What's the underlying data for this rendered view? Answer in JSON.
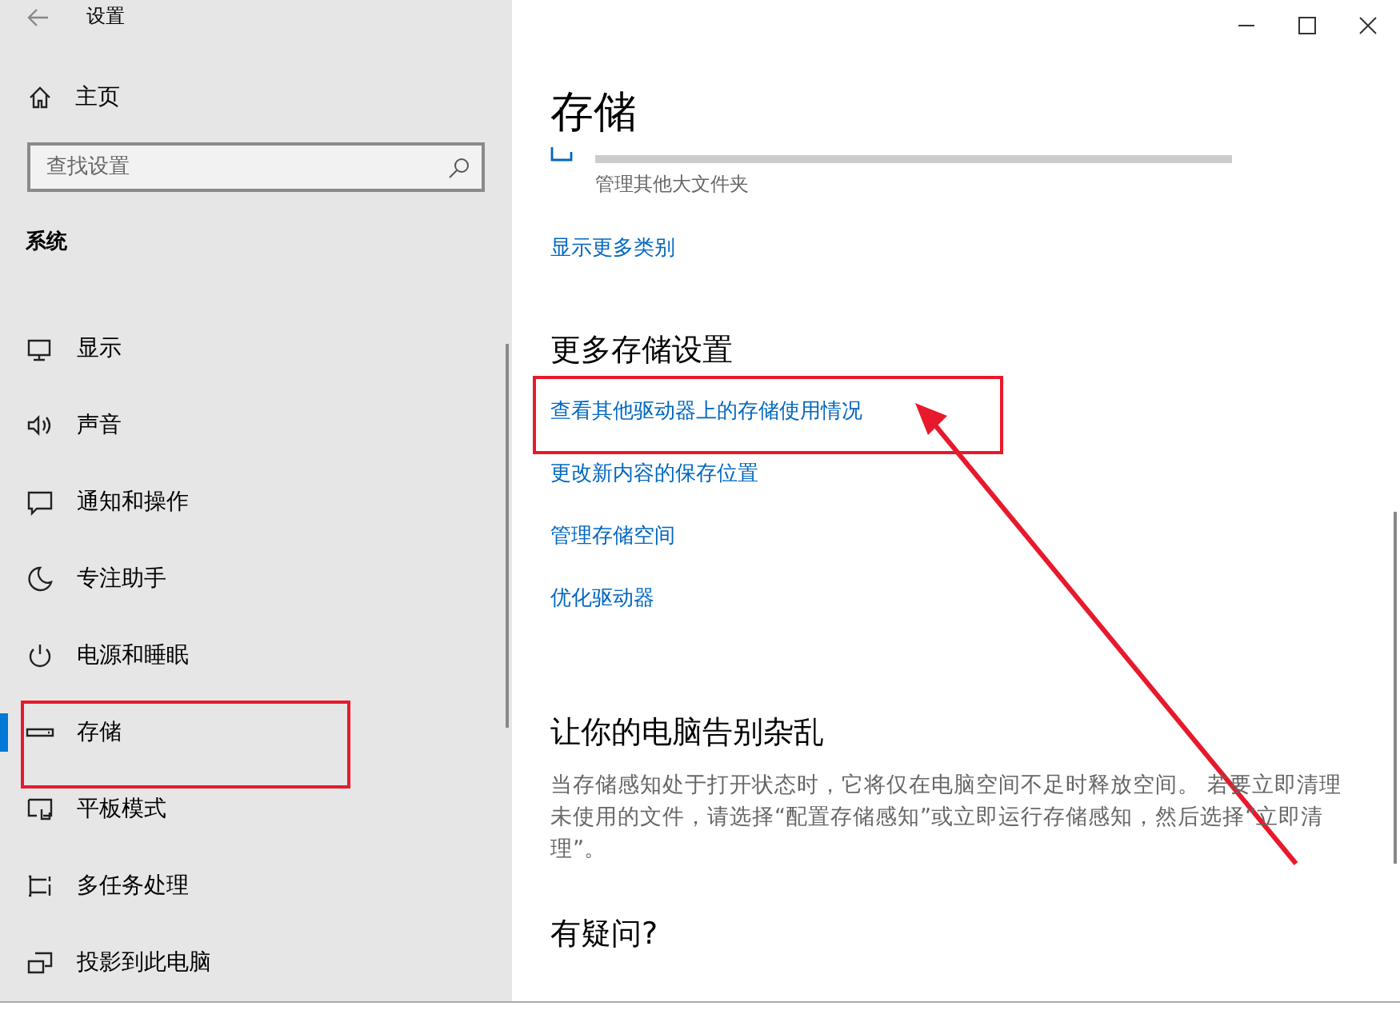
{
  "window": {
    "title": "设置"
  },
  "sidebar": {
    "home": "主页",
    "search": {
      "placeholder": "查找设置"
    },
    "section": "系统",
    "items": [
      {
        "label": "显示",
        "kind": "display",
        "selected": false
      },
      {
        "label": "声音",
        "kind": "sound",
        "selected": false
      },
      {
        "label": "通知和操作",
        "kind": "notify",
        "selected": false
      },
      {
        "label": "专注助手",
        "kind": "moon",
        "selected": false
      },
      {
        "label": "电源和睡眠",
        "kind": "power",
        "selected": false
      },
      {
        "label": "存储",
        "kind": "storage",
        "selected": true
      },
      {
        "label": "平板模式",
        "kind": "tablet",
        "selected": false
      },
      {
        "label": "多任务处理",
        "kind": "multitask",
        "selected": false
      },
      {
        "label": "投影到此电脑",
        "kind": "project",
        "selected": false
      }
    ]
  },
  "main": {
    "title": "存储",
    "category": {
      "caption": "管理其他大文件夹",
      "level": 0
    },
    "more_link": "显示更多类别",
    "more_settings": {
      "heading": "更多存储设置",
      "links": [
        "查看其他驱动器上的存储使用情况",
        "更改新内容的保存位置",
        "管理存储空间",
        "优化驱动器"
      ]
    },
    "declutter": {
      "heading": "让你的电脑告别杂乱",
      "text": "当存储感知处于打开状态时，它将仅在电脑空间不足时释放空间。 若要立即清理未使用的文件，请选择“配置存储感知”或立即运行存储感知，然后选择“立即清理”。"
    },
    "questions": {
      "heading": "有疑问?"
    }
  }
}
